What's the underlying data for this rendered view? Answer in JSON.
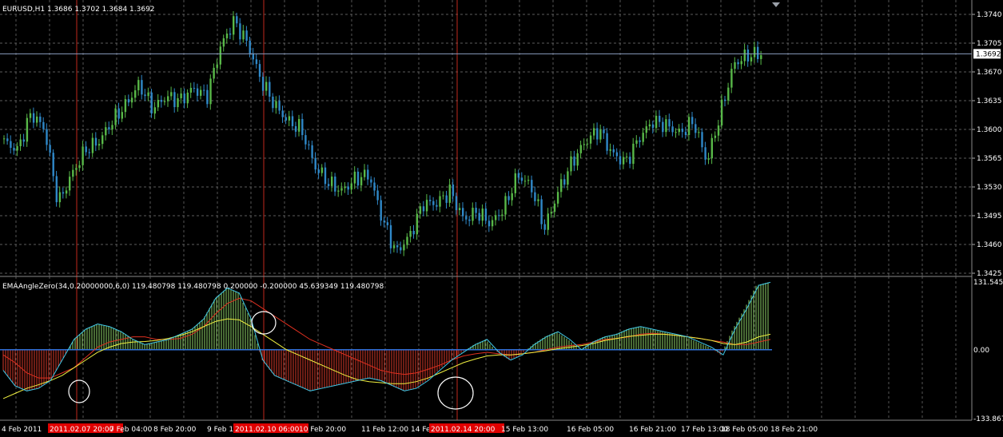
{
  "window": {
    "main_title": "EURUSD,H1  1.3686 1.3702 1.3684 1.3692",
    "indicator_title": "EMAAngleZero(34,0.20000000,6,0)  119.480798  119.480798  0.200000  -0.200000  45.639349  119.480798"
  },
  "colors": {
    "background": "#000000",
    "grid": "#7a7a7a",
    "bull_candle": "#58b848",
    "bear_candle": "#2f88c8",
    "histogram_positive": "#8fd36a",
    "histogram_negative": "#d83a2a",
    "zero_line": "#2f6fd8",
    "signal_line": "#f0f040",
    "slow_line": "#e03020",
    "angle_line": "#40c8e8",
    "vertical_markers": "#c0281c",
    "highlight_label_bg": "#e00000",
    "bid_line": "#8a9cbf",
    "circle_marks": "#ffffff"
  },
  "chart_data": [
    {
      "type": "candlestick",
      "symbol": "EURUSD",
      "timeframe": "H1",
      "last_quote": {
        "open": 1.3686,
        "high": 1.3702,
        "low": 1.3684,
        "close": 1.3692
      },
      "current_price_label": "1.3692",
      "current_price": 1.3692,
      "ylim": [
        1.3425,
        1.374
      ],
      "price_ticks": [
        "1.3740",
        "1.3705",
        "1.3670",
        "1.3635",
        "1.3600",
        "1.3565",
        "1.3530",
        "1.3495",
        "1.3460",
        "1.3425"
      ],
      "close_path": [
        1.3585,
        1.3575,
        1.362,
        1.36,
        1.351,
        1.3545,
        1.3575,
        1.3585,
        1.361,
        1.363,
        1.3655,
        1.3625,
        1.364,
        1.3635,
        1.365,
        1.364,
        1.37,
        1.3732,
        1.3705,
        1.366,
        1.363,
        1.361,
        1.36,
        1.3555,
        1.3535,
        1.3525,
        1.354,
        1.3545,
        1.349,
        1.345,
        1.347,
        1.351,
        1.351,
        1.3525,
        1.349,
        1.35,
        1.3485,
        1.3505,
        1.3545,
        1.353,
        1.348,
        1.3525,
        1.356,
        1.3585,
        1.36,
        1.357,
        1.356,
        1.359,
        1.361,
        1.3605,
        1.3595,
        1.361,
        1.356,
        1.362,
        1.368,
        1.369,
        1.3692
      ]
    },
    {
      "type": "histogram",
      "name": "EMAAngleZero(34,0.20000000,6,0)",
      "ylim": [
        -133.867,
        131.545
      ],
      "y_ticks": [
        "131.5450",
        "0.00",
        "-133.867"
      ],
      "histogram": [
        -40,
        -70,
        -80,
        -75,
        -60,
        -20,
        20,
        40,
        50,
        45,
        35,
        20,
        10,
        15,
        20,
        30,
        40,
        60,
        100,
        120,
        110,
        60,
        -20,
        -50,
        -60,
        -70,
        -80,
        -75,
        -70,
        -65,
        -60,
        -55,
        -60,
        -70,
        -80,
        -75,
        -60,
        -40,
        -20,
        -5,
        10,
        20,
        -5,
        -20,
        -10,
        10,
        25,
        35,
        20,
        0,
        15,
        25,
        30,
        40,
        45,
        40,
        35,
        30,
        25,
        15,
        5,
        -10,
        40,
        80,
        125,
        131
      ],
      "signal": [
        -95,
        -85,
        -75,
        -68,
        -60,
        -50,
        -35,
        -20,
        -5,
        5,
        12,
        15,
        16,
        18,
        22,
        28,
        35,
        45,
        55,
        60,
        58,
        45,
        30,
        15,
        0,
        -10,
        -20,
        -30,
        -40,
        -50,
        -58,
        -62,
        -64,
        -66,
        -66,
        -62,
        -55,
        -45,
        -35,
        -25,
        -18,
        -12,
        -10,
        -10,
        -8,
        -5,
        -2,
        2,
        5,
        8,
        12,
        18,
        22,
        26,
        28,
        30,
        30,
        28,
        25,
        22,
        18,
        12,
        10,
        15,
        25,
        30
      ],
      "slow": [
        -10,
        -25,
        -45,
        -55,
        -55,
        -45,
        -35,
        -15,
        5,
        15,
        20,
        25,
        25,
        20,
        20,
        22,
        30,
        45,
        70,
        90,
        100,
        95,
        80,
        65,
        50,
        35,
        20,
        10,
        0,
        -10,
        -20,
        -30,
        -40,
        -45,
        -48,
        -45,
        -38,
        -30,
        -20,
        -12,
        -8,
        -5,
        -8,
        -10,
        -8,
        -5,
        0,
        5,
        8,
        10,
        15,
        20,
        22,
        25,
        30,
        32,
        30,
        28,
        25,
        22,
        18,
        15,
        10,
        10,
        15,
        20
      ],
      "angle": [
        -40,
        -70,
        -80,
        -75,
        -60,
        -20,
        20,
        40,
        50,
        45,
        35,
        20,
        10,
        15,
        20,
        30,
        40,
        60,
        100,
        120,
        110,
        60,
        -20,
        -50,
        -60,
        -70,
        -80,
        -75,
        -70,
        -65,
        -60,
        -55,
        -60,
        -70,
        -80,
        -75,
        -60,
        -40,
        -20,
        -5,
        10,
        20,
        -5,
        -20,
        -10,
        10,
        25,
        35,
        20,
        0,
        15,
        25,
        30,
        40,
        45,
        40,
        35,
        30,
        25,
        15,
        5,
        -10,
        40,
        80,
        125,
        131
      ]
    }
  ],
  "time_axis": {
    "labels": [
      "4 Feb 2011",
      "2011.02.07 20:00",
      "7 Feb 04:00",
      "8 Feb 20:00",
      "9 Feb 12:",
      "2011.02.10 06:00",
      "10 Feb 20:00",
      "11 Feb 12:00",
      "14 Feb",
      "2011.02.14 20:00",
      "15 Feb 13:00",
      "16 Feb 05:00",
      "16 Feb 21:00",
      "17 Feb 13:00",
      "18 Feb 05:00",
      "18 Feb 21:00"
    ],
    "highlighted": [
      "2011.02.07 20:00",
      "2011.02.10 06:00",
      "2011.02.14 20:00"
    ]
  }
}
